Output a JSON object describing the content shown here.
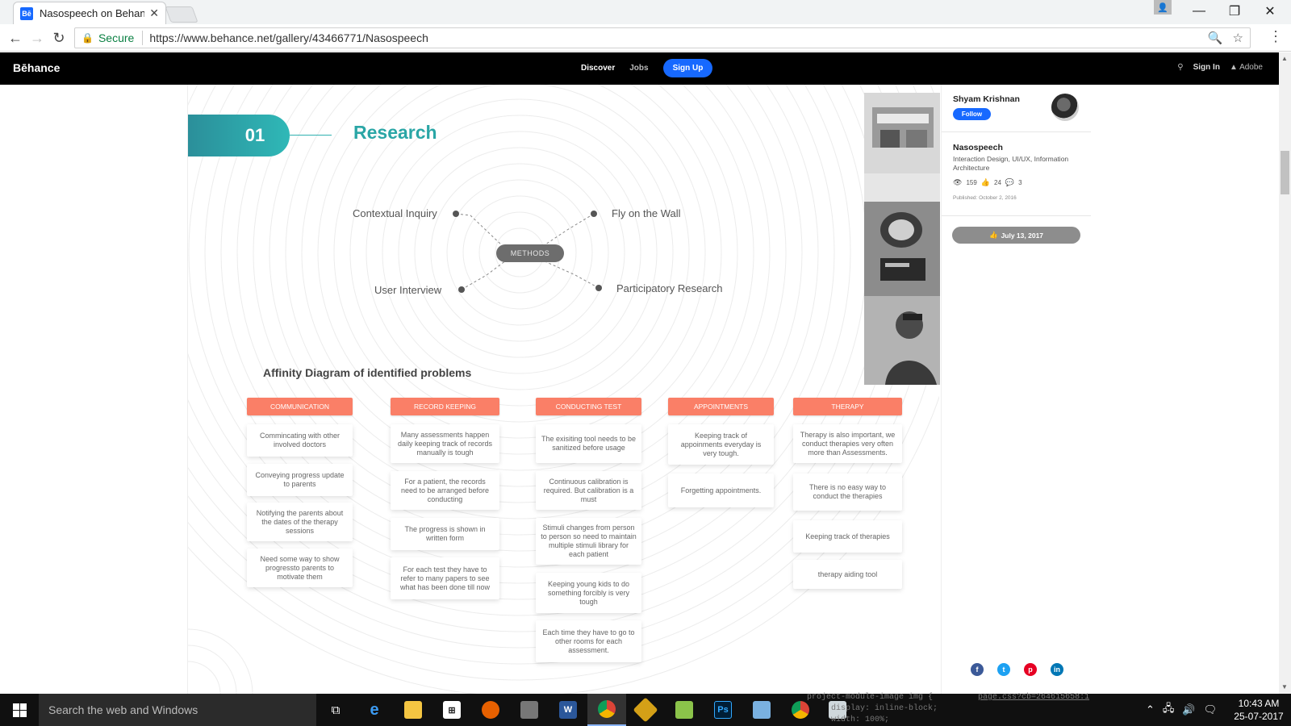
{
  "browser": {
    "tab_title": "Nasospeech on Behance",
    "tab_favicon": "Bē",
    "secure_label": "Secure",
    "url": "https://www.behance.net/gallery/43466771/Nasospeech"
  },
  "behance": {
    "logo": "Bēhance",
    "nav": {
      "discover": "Discover",
      "jobs": "Jobs",
      "signup": "Sign Up"
    },
    "signin": "Sign In",
    "adobe": "Adobe"
  },
  "research": {
    "number": "01",
    "title": "Research",
    "center": "METHODS",
    "methods": [
      "Contextual Inquiry",
      "Fly on the Wall",
      "User Interview",
      "Participatory Research"
    ]
  },
  "affinity": {
    "title": "Affinity Diagram of identified problems",
    "columns": [
      {
        "header": "COMMUNICATION",
        "cards": [
          "Commincating with other involved doctors",
          "Conveying progress update to parents",
          "Notifying the parents about the dates of the therapy sessions",
          "Need some way to show progressto parents to motivate them"
        ]
      },
      {
        "header": "RECORD KEEPING",
        "cards": [
          "Many assessments happen daily keeping track of records manually is tough",
          "For a patient, the records need to be arranged before conducting",
          "The progress is shown in written form",
          "For each test they have to refer to many papers to see what has been done till now"
        ]
      },
      {
        "header": "CONDUCTING TEST",
        "cards": [
          "The exisiting tool needs to be sanitized before usage",
          "Continuous calibration is required. But calibration is a must",
          "Stimuli changes from person to person so need to maintain multiple stimuli library for each patient",
          "Keeping young kids to do something forcibly is very tough",
          "Each time they have to go to other rooms for each assessment."
        ]
      },
      {
        "header": "APPOINTMENTS",
        "cards": [
          "Keeping track of appoinments everyday is very tough.",
          "Forgetting appointments."
        ]
      },
      {
        "header": "THERAPY",
        "cards": [
          "Therapy is also important, we conduct therapies very often more than Assessments.",
          "There is no easy way to conduct the therapies",
          "Keeping track of therapies",
          "therapy aiding tool"
        ]
      }
    ]
  },
  "sidebar": {
    "owner": "Shyam Krishnan",
    "follow": "Follow",
    "project": "Nasospeech",
    "fields": "Interaction Design, UI/UX, Information Architecture",
    "views": "159",
    "appreciations": "24",
    "comments": "3",
    "published": "Published: October 2, 2016",
    "appreciated_date": "July 13, 2017"
  },
  "code_overlay": {
    "line1": "project-module-image img {",
    "line1_link": "page.css?cb=264615658:1",
    "line2": "display: inline-block;",
    "line3": "width: 100%;"
  },
  "taskbar": {
    "search_placeholder": "Search the web and Windows",
    "time": "10:43 AM",
    "date": "25-07-2017"
  },
  "colors": {
    "behance_blue": "#1769ff",
    "teal": "#2aa6a6",
    "coral": "#fa7f67"
  }
}
